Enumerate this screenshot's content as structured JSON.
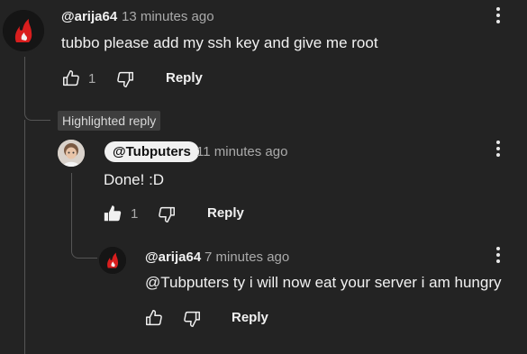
{
  "comment": {
    "handle": "@arija64",
    "time": "13 minutes ago",
    "text": "tubbo please add my ssh key and give me root",
    "likes": "1",
    "reply_label": "Reply"
  },
  "highlight_label": "Highlighted reply",
  "reply1": {
    "handle": "@Tubputers",
    "time": "11 minutes ago",
    "text": "Done! :D",
    "likes": "1",
    "reply_label": "Reply"
  },
  "reply2": {
    "handle": "@arija64",
    "time": "7 minutes ago",
    "text": "@Tubputers ty i will now eat your server i am hungry",
    "reply_label": "Reply"
  },
  "colors": {
    "background": "#232323",
    "secondary_text": "#aaaaaa",
    "avatar_red": "#d81e1e"
  }
}
